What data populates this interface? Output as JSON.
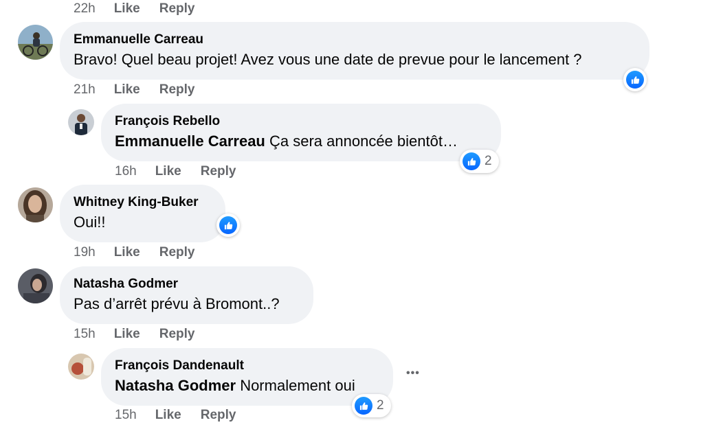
{
  "labels": {
    "like": "Like",
    "reply": "Reply"
  },
  "top_meta": {
    "time": "22h"
  },
  "comments": [
    {
      "author": "Emmanuelle Carreau",
      "text": "Bravo! Quel beau projet! Avez vous une date de prevue pour le lancement ?",
      "time": "21h",
      "reply": {
        "author": "François Rebello",
        "mention": "Emmanuelle Carreau",
        "text": "Ça sera annoncée bientôt…",
        "time": "16h",
        "reaction_count": "2"
      }
    },
    {
      "author": "Whitney King-Buker",
      "text": "Oui!!",
      "time": "19h"
    },
    {
      "author": "Natasha Godmer",
      "text": "Pas d’arrêt prévu à Bromont..?",
      "time": "15h",
      "reply": {
        "author": "François Dandenault",
        "mention": "Natasha Godmer",
        "text": "Normalement oui",
        "time": "15h",
        "reaction_count": "2",
        "more": "•••"
      }
    }
  ],
  "colors": {
    "bubble": "#f0f2f5",
    "meta": "#65676b",
    "like_blue": "#0866ff"
  },
  "icons": {
    "reaction": "thumbs-up-icon",
    "more": "more-options-icon"
  }
}
